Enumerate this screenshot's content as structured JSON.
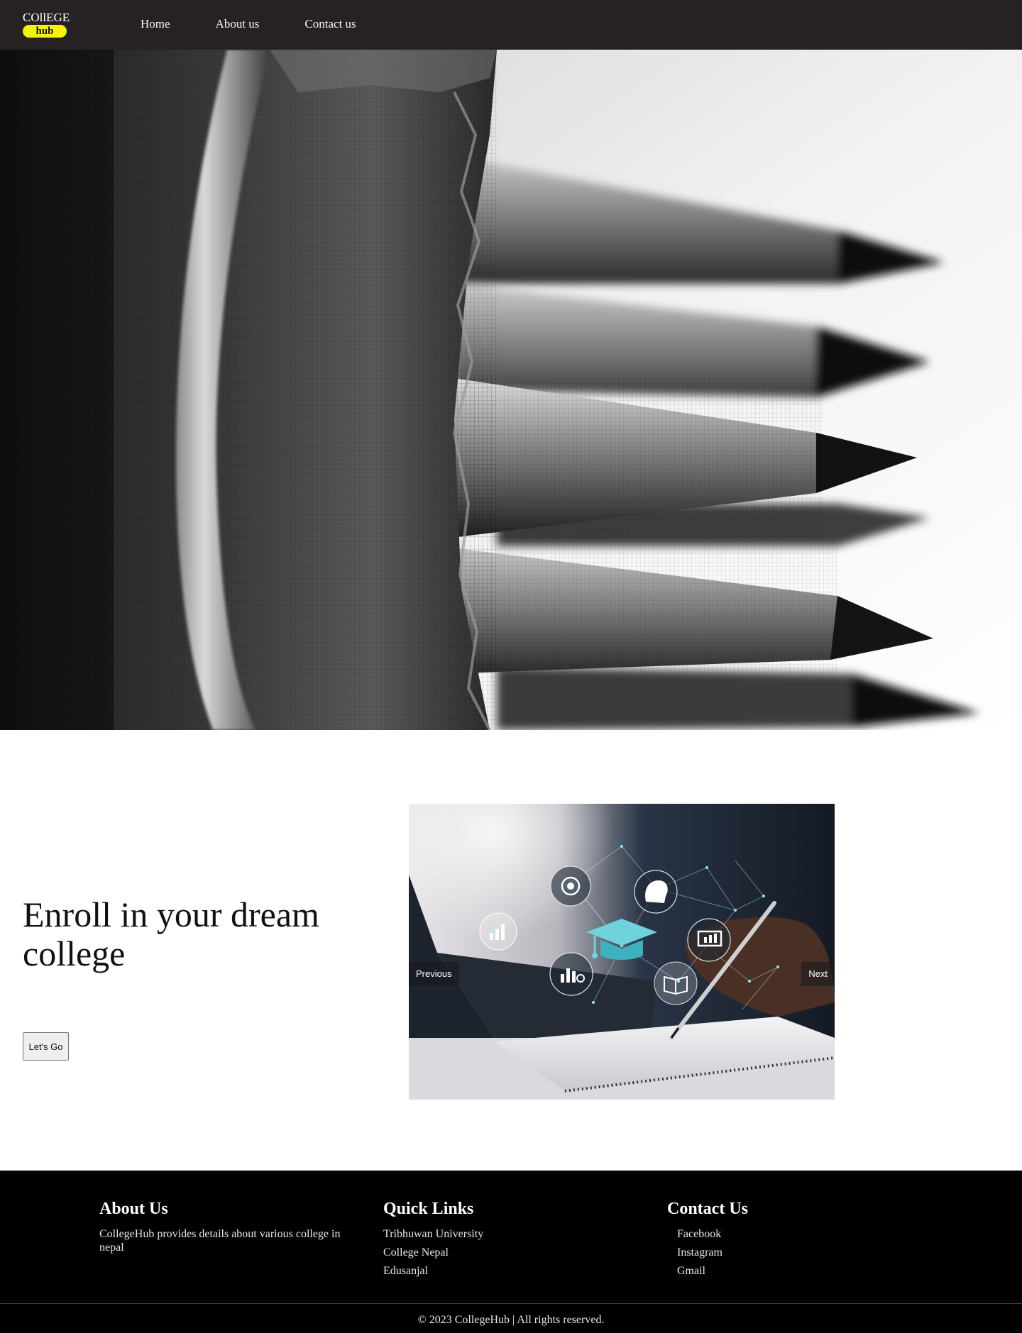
{
  "navbar": {
    "logo_top": "COllEGE",
    "logo_bottom": "hub",
    "links": [
      "Home",
      "About us",
      "Contact us"
    ]
  },
  "enroll": {
    "title": "Enroll in your dream college",
    "button": "Let's Go",
    "carousel": {
      "prev_label": "Previous",
      "next_label": "Next"
    }
  },
  "footer": {
    "about": {
      "heading": "About Us",
      "text": "CollegeHub provides details about various college in nepal"
    },
    "quick_links": {
      "heading": "Quick Links",
      "items": [
        "Tribhuwan University",
        "College Nepal",
        "Edusanjal"
      ]
    },
    "contact": {
      "heading": "Contact Us",
      "items": [
        "Facebook",
        "Instagram",
        "Gmail"
      ]
    },
    "copyright": "© 2023 CollegeHub | All rights reserved."
  },
  "colors": {
    "navbar_bg": "#262223",
    "logo_accent": "#f6f20a",
    "footer_bg": "#000000",
    "footer_rule": "#7a2a22"
  },
  "icons": [
    "target-icon",
    "brain-gear-icon",
    "graduation-cap-icon",
    "bar-chart-icon",
    "presentation-icon",
    "book-icon",
    "analytics-icon"
  ]
}
